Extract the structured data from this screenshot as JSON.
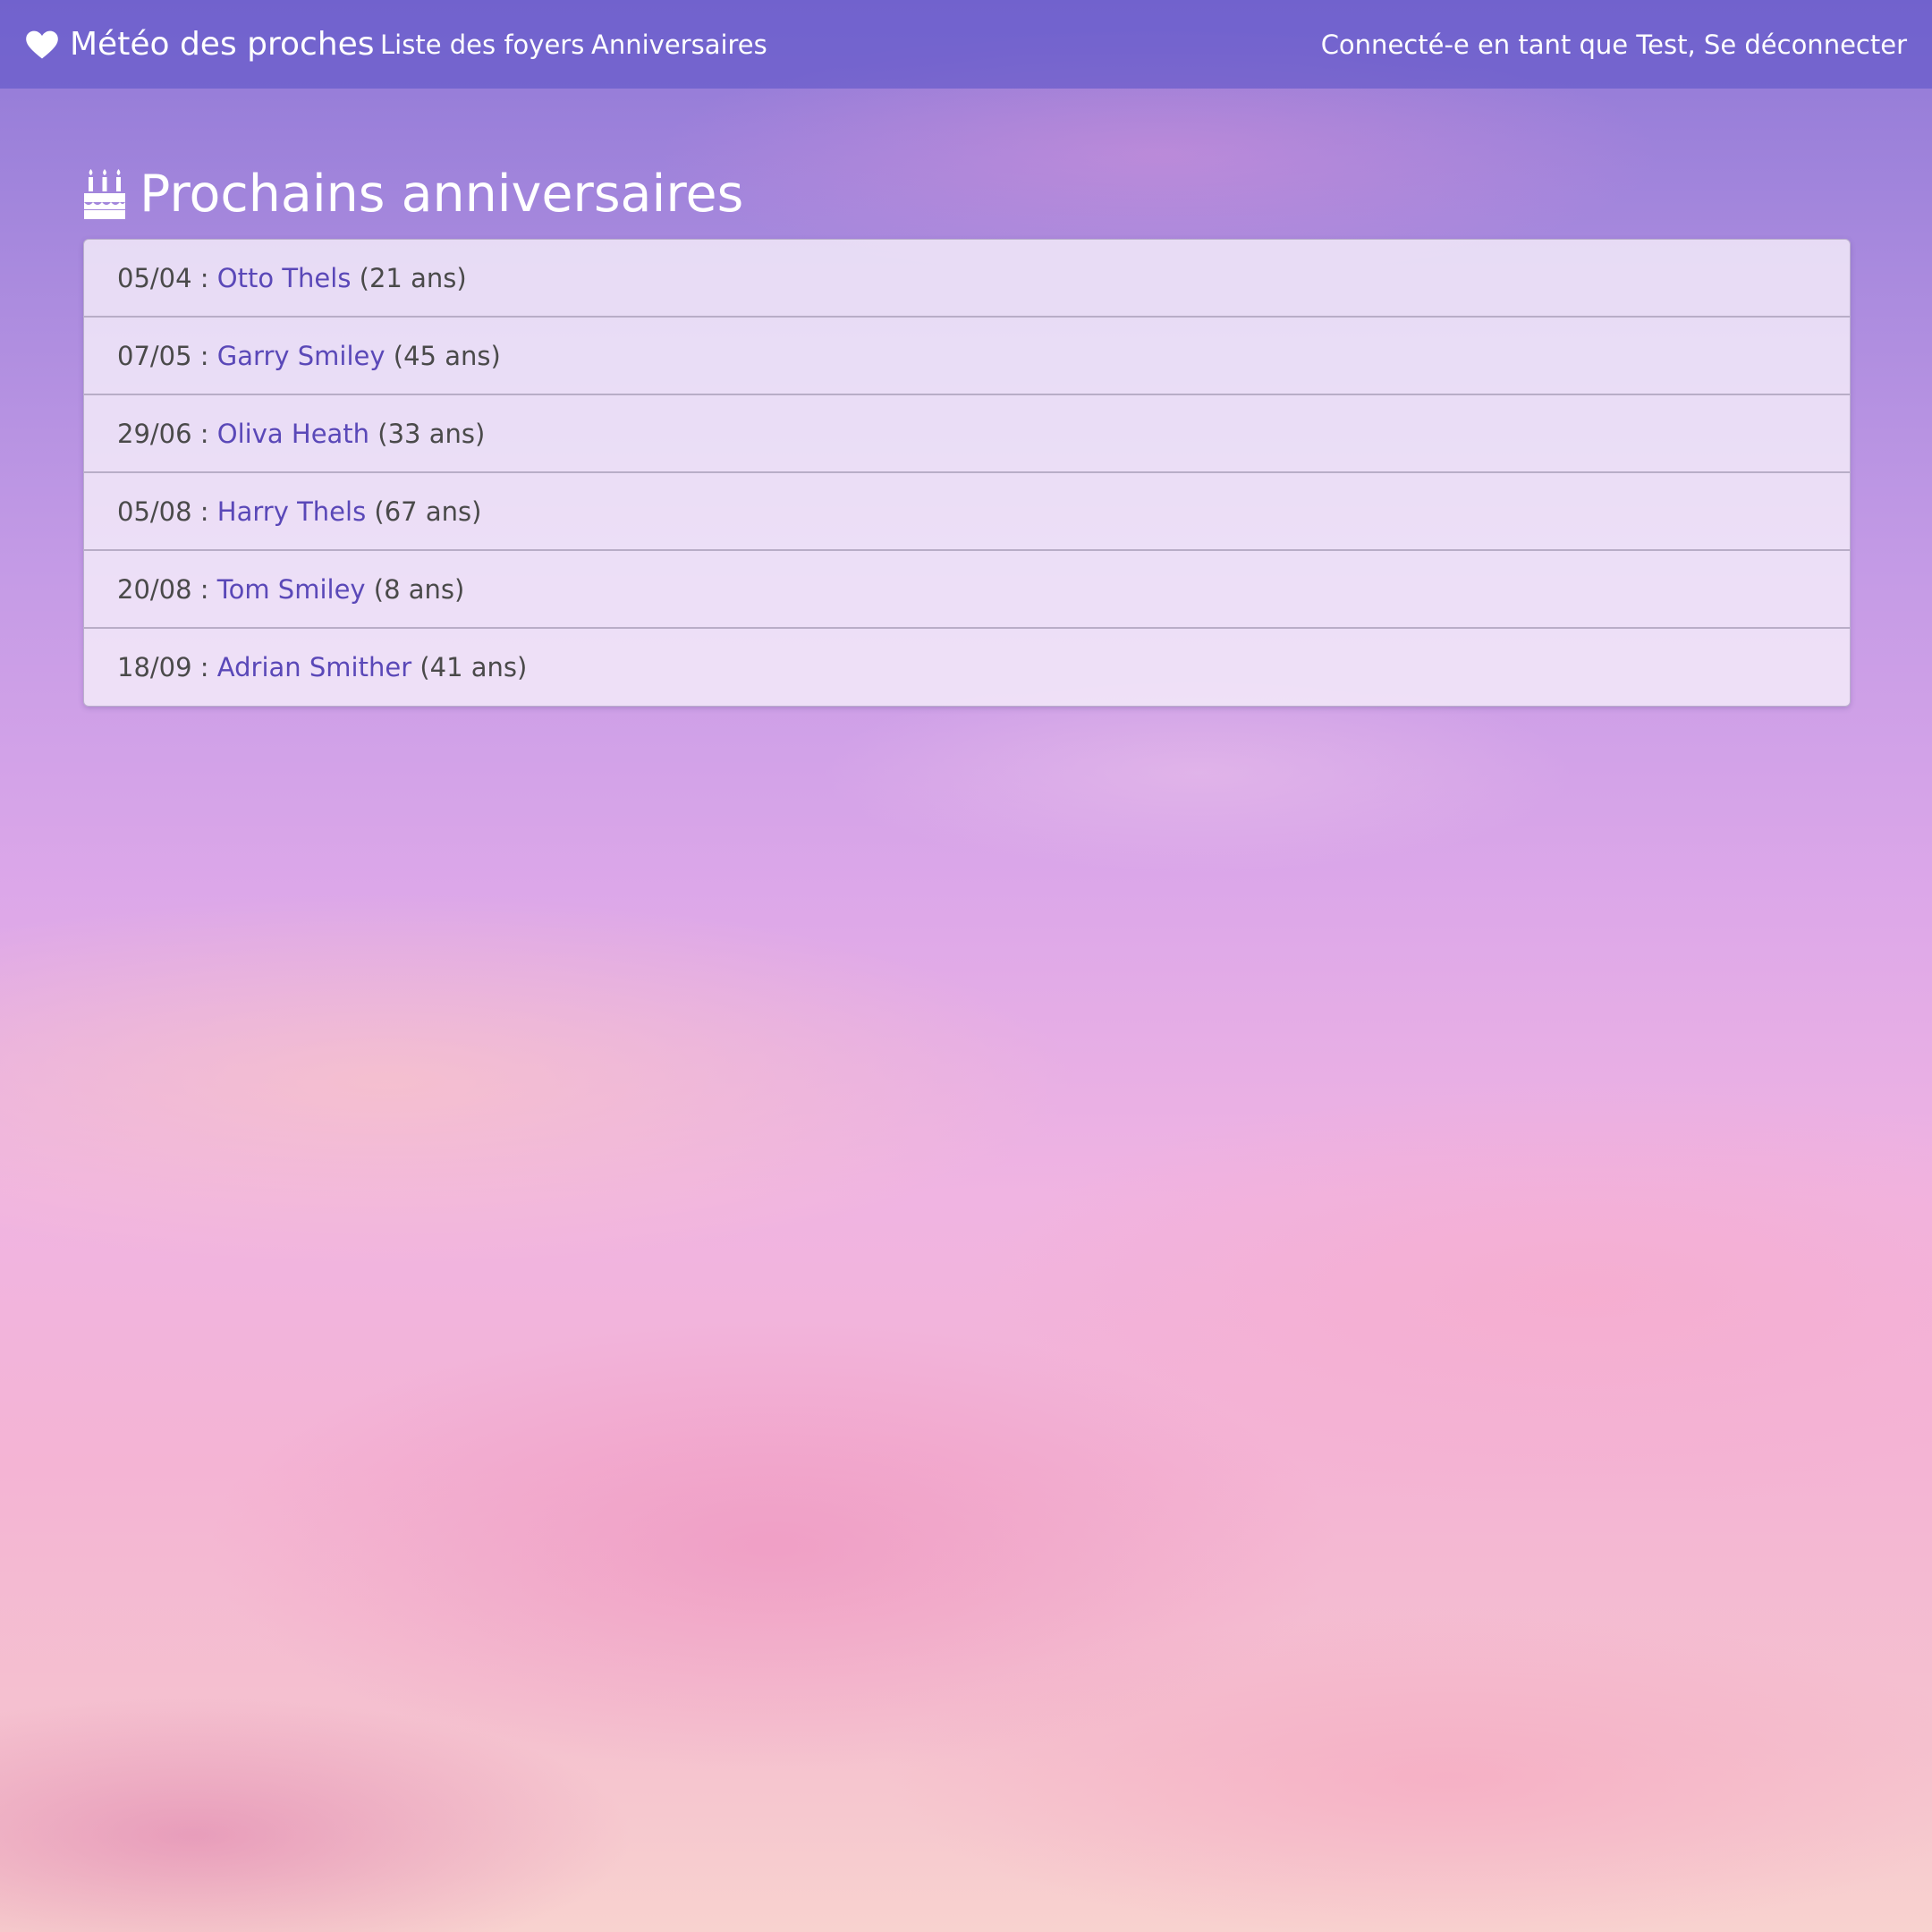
{
  "navbar": {
    "brand_label": "Météo des proches",
    "brand_icon": "heart-icon",
    "links": [
      {
        "label": "Liste des foyers"
      },
      {
        "label": "Anniversaires"
      }
    ],
    "logged_in_text": "Connecté-e en tant que Test,",
    "logout_label": "Se déconnecter",
    "background_color": "#5f55c8"
  },
  "page": {
    "title": "Prochains anniversaires",
    "title_icon": "birthday-cake-icon"
  },
  "birthdays": [
    {
      "date": "05/04",
      "name": "Otto Thels",
      "age": "(21 ans)"
    },
    {
      "date": "07/05",
      "name": "Garry Smiley",
      "age": "(45 ans)"
    },
    {
      "date": "29/06",
      "name": "Oliva Heath",
      "age": "(33 ans)"
    },
    {
      "date": "05/08",
      "name": "Harry Thels",
      "age": "(67 ans)"
    },
    {
      "date": "20/08",
      "name": "Tom Smiley",
      "age": "(8 ans)"
    },
    {
      "date": "18/09",
      "name": "Adrian Smither",
      "age": "(41 ans)"
    }
  ],
  "colors": {
    "link": "#5a48b8",
    "text": "#4a4a4a",
    "heading": "#ffffff"
  }
}
